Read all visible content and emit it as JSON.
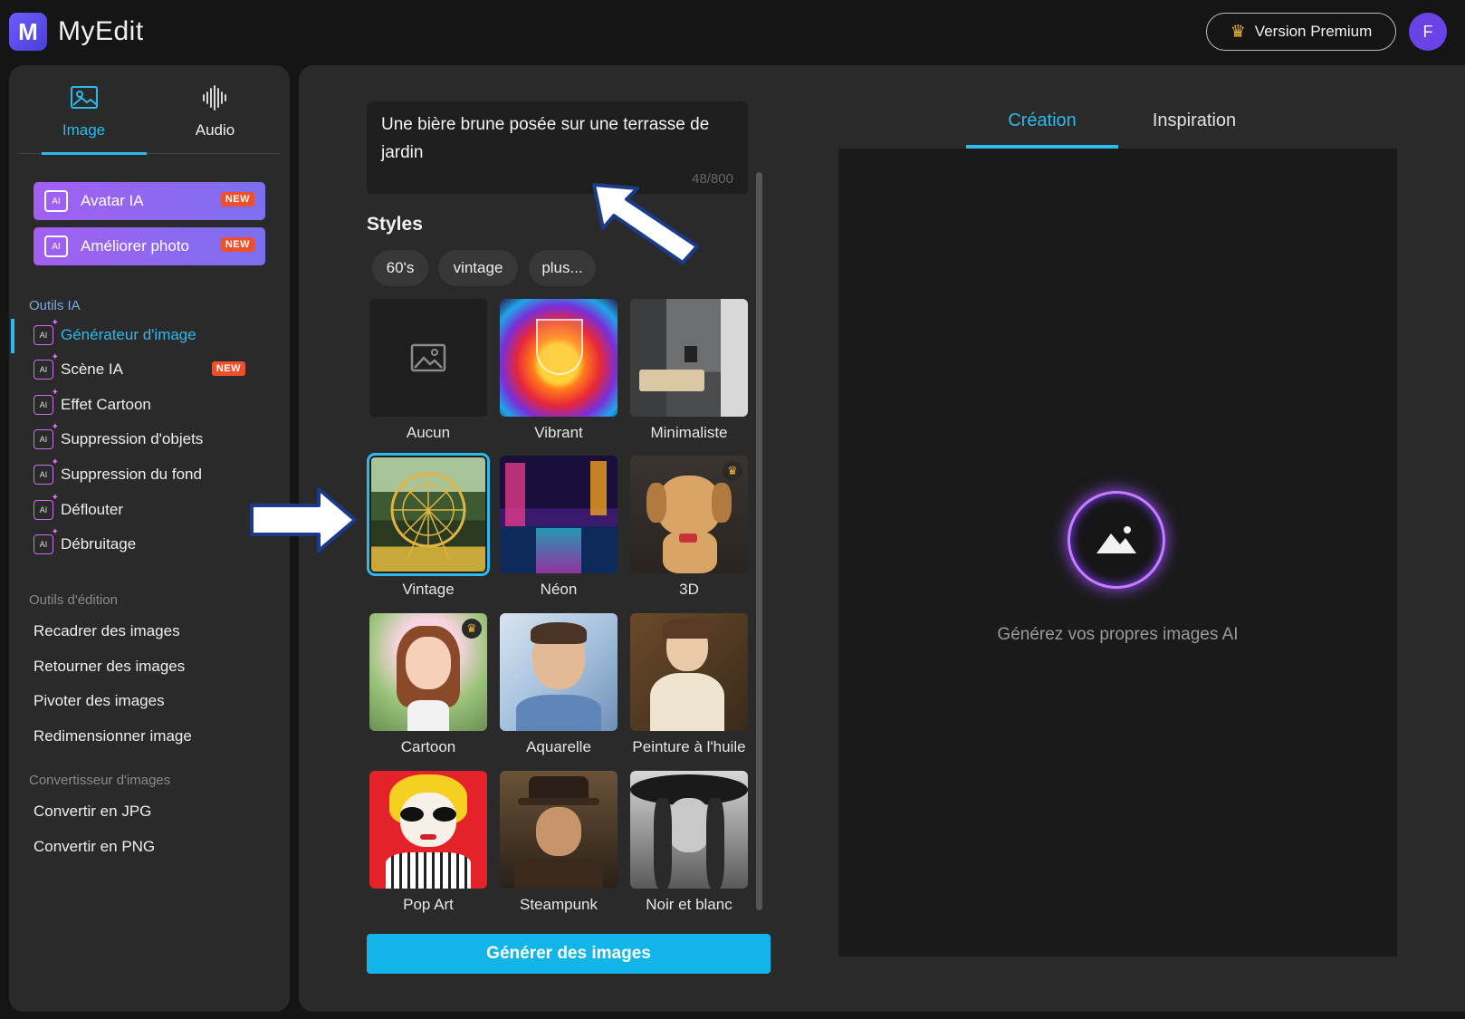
{
  "app": {
    "logo_letter": "M",
    "name": "MyEdit"
  },
  "header": {
    "premium_label": "Version Premium",
    "avatar_initial": "F"
  },
  "sidebar": {
    "tabs": [
      {
        "label": "Image",
        "icon": "image-icon",
        "active": true
      },
      {
        "label": "Audio",
        "icon": "audio-waveform-icon",
        "active": false
      }
    ],
    "promos": [
      {
        "label": "Avatar IA",
        "badge": "NEW"
      },
      {
        "label": "Améliorer photo",
        "badge": "NEW"
      }
    ],
    "sections": {
      "ai_tools": "Outils IA",
      "edit_tools": "Outils d'édition",
      "converter": "Convertisseur d'images"
    },
    "ai_tools": [
      {
        "label": "Générateur d'image",
        "active": true
      },
      {
        "label": "Scène IA",
        "badge": "NEW"
      },
      {
        "label": "Effet Cartoon"
      },
      {
        "label": "Suppression d'objets"
      },
      {
        "label": "Suppression du fond"
      },
      {
        "label": "Déflouter"
      },
      {
        "label": "Débruitage"
      }
    ],
    "edit_tools": [
      "Recadrer des images",
      "Retourner des images",
      "Pivoter des images",
      "Redimensionner image"
    ],
    "converter_tools": [
      "Convertir en JPG",
      "Convertir en PNG"
    ],
    "tool_icon_text": "AI"
  },
  "generator": {
    "prompt": "Une bière brune posée sur une terrasse de jardin",
    "counter": "48/800",
    "styles_title": "Styles",
    "chips": [
      "60's",
      "vintage",
      "plus..."
    ],
    "styles": [
      {
        "label": "Aucun",
        "premium": false
      },
      {
        "label": "Vibrant",
        "premium": false
      },
      {
        "label": "Minimaliste",
        "premium": false
      },
      {
        "label": "Vintage",
        "premium": false,
        "selected": true
      },
      {
        "label": "Néon",
        "premium": false
      },
      {
        "label": "3D",
        "premium": true
      },
      {
        "label": "Cartoon",
        "premium": true
      },
      {
        "label": "Aquarelle",
        "premium": false
      },
      {
        "label": "Peinture à l'huile",
        "premium": false
      },
      {
        "label": "Pop Art",
        "premium": false
      },
      {
        "label": "Steampunk",
        "premium": false
      },
      {
        "label": "Noir et blanc",
        "premium": false
      }
    ],
    "generate_label": "Générer des images"
  },
  "result": {
    "tabs": [
      {
        "label": "Création",
        "active": true
      },
      {
        "label": "Inspiration",
        "active": false
      }
    ],
    "empty_text": "Générez vos propres images AI"
  },
  "colors": {
    "accent": "#2bb9ee",
    "promo_start": "#a25ff2",
    "badge": "#ef4f2a",
    "generate": "#13b5e8"
  }
}
